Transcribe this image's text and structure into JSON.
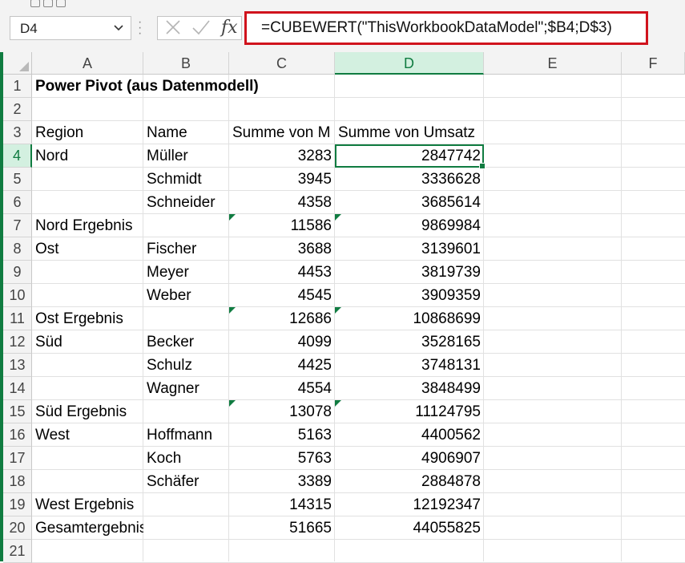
{
  "formula_bar": {
    "name_box": "D4",
    "cancel_icon": "close-icon",
    "enter_icon": "check-icon",
    "function_label": "fx",
    "formula": "=CUBEWERT(\"ThisWorkbookDataModel\";$B4;D$3)"
  },
  "columns": [
    "A",
    "B",
    "C",
    "D",
    "E",
    "F"
  ],
  "rows": [
    "1",
    "2",
    "3",
    "4",
    "5",
    "6",
    "7",
    "8",
    "9",
    "10",
    "11",
    "12",
    "13",
    "14",
    "15",
    "16",
    "17",
    "18",
    "19",
    "20",
    "21"
  ],
  "selected_cell": "D4",
  "colors": {
    "accent": "#107c41",
    "highlight_border": "#d0131d"
  },
  "sheet": {
    "title": "Power Pivot (aus Datenmodell)",
    "headers": [
      "Region",
      "Name",
      "Summe von M",
      "Summe von Umsatz"
    ],
    "data_rows": [
      [
        "Nord",
        "Müller",
        "3283",
        "2847742"
      ],
      [
        "",
        "Schmidt",
        "3945",
        "3336628"
      ],
      [
        "",
        "Schneider",
        "4358",
        "3685614"
      ],
      [
        "Nord Ergebnis",
        "",
        "11586",
        "9869984"
      ],
      [
        "Ost",
        "Fischer",
        "3688",
        "3139601"
      ],
      [
        "",
        "Meyer",
        "4453",
        "3819739"
      ],
      [
        "",
        "Weber",
        "4545",
        "3909359"
      ],
      [
        "Ost Ergebnis",
        "",
        "12686",
        "10868699"
      ],
      [
        "Süd",
        "Becker",
        "4099",
        "3528165"
      ],
      [
        "",
        "Schulz",
        "4425",
        "3748131"
      ],
      [
        "",
        "Wagner",
        "4554",
        "3848499"
      ],
      [
        "Süd Ergebnis",
        "",
        "13078",
        "11124795"
      ],
      [
        "West",
        "Hoffmann",
        "5163",
        "4400562"
      ],
      [
        "",
        "Koch",
        "5763",
        "4906907"
      ],
      [
        "",
        "Schäfer",
        "3389",
        "2884878"
      ],
      [
        "West Ergebnis",
        "",
        "14315",
        "12192347"
      ],
      [
        "Gesamtergebnis",
        "",
        "51665",
        "44055825"
      ]
    ]
  }
}
